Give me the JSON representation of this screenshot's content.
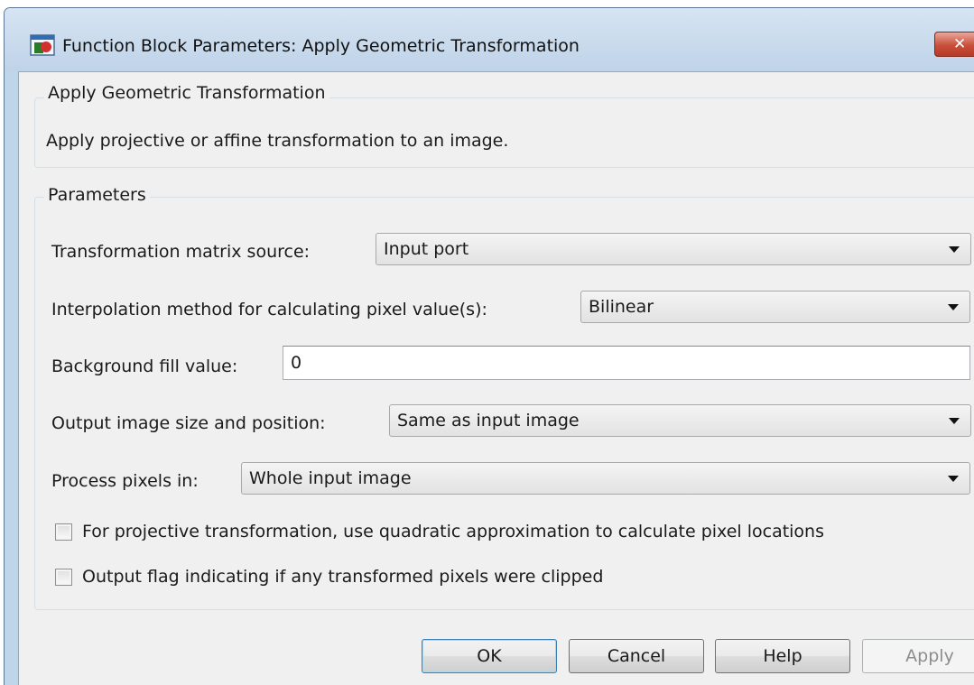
{
  "window": {
    "title": "Function Block Parameters: Apply Geometric Transformation",
    "close_label": "✕"
  },
  "description_group": {
    "legend": "Apply Geometric Transformation",
    "text": "Apply projective or affine transformation to an image."
  },
  "parameters_group": {
    "legend": "Parameters",
    "transformation_matrix_source": {
      "label": "Transformation matrix source:",
      "value": "Input port"
    },
    "interpolation_method": {
      "label": "Interpolation method for calculating pixel value(s):",
      "value": "Bilinear"
    },
    "background_fill_value": {
      "label": "Background fill value:",
      "value": "0"
    },
    "output_image_size": {
      "label": "Output image size and position:",
      "value": "Same as input image"
    },
    "process_pixels_in": {
      "label": "Process pixels in:",
      "value": "Whole input image"
    },
    "quadratic_approximation": {
      "label": "For projective transformation, use quadratic approximation to calculate pixel locations",
      "checked": false
    },
    "output_clip_flag": {
      "label": "Output flag indicating if any transformed pixels were clipped",
      "checked": false
    }
  },
  "buttons": {
    "ok": "OK",
    "cancel": "Cancel",
    "help": "Help",
    "apply": "Apply"
  },
  "icons": {
    "app": "simulink-block-icon",
    "close": "close-icon",
    "dropdown": "chevron-down-icon"
  },
  "colors": {
    "titlebar": "#bfd3e8",
    "client_background": "#f0f0f0",
    "close_button": "#c94f3b",
    "default_button_border": "#3c7fb1"
  }
}
